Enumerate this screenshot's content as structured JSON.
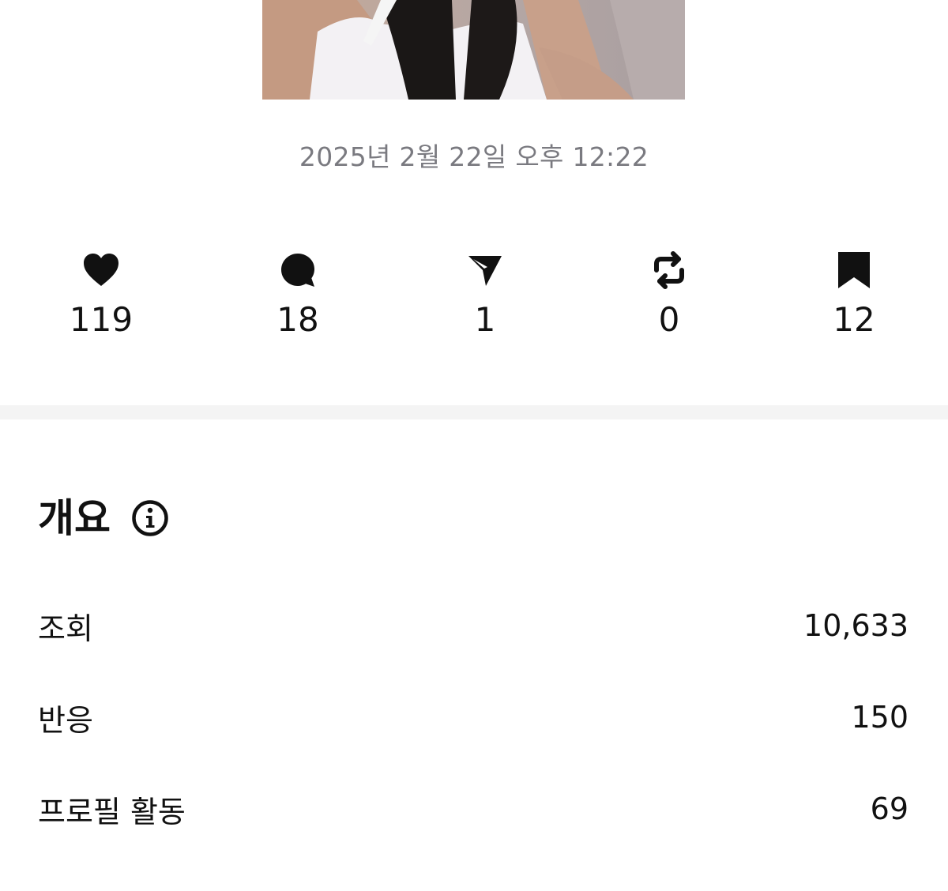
{
  "post": {
    "timestamp": "2025년 2월 22일 오후 12:22"
  },
  "actions": [
    {
      "icon": "heart-icon",
      "count": "119"
    },
    {
      "icon": "comment-icon",
      "count": "18"
    },
    {
      "icon": "send-icon",
      "count": "1"
    },
    {
      "icon": "repost-icon",
      "count": "0"
    },
    {
      "icon": "bookmark-icon",
      "count": "12"
    }
  ],
  "overview": {
    "title": "개요",
    "info_icon": "info-icon",
    "stats": [
      {
        "label": "조회",
        "value": "10,633"
      },
      {
        "label": "반응",
        "value": "150"
      },
      {
        "label": "프로필 활동",
        "value": "69"
      }
    ]
  },
  "colors": {
    "text": "#111111",
    "muted": "#7a7a80",
    "divider": "#f4f4f4",
    "background": "#ffffff"
  }
}
